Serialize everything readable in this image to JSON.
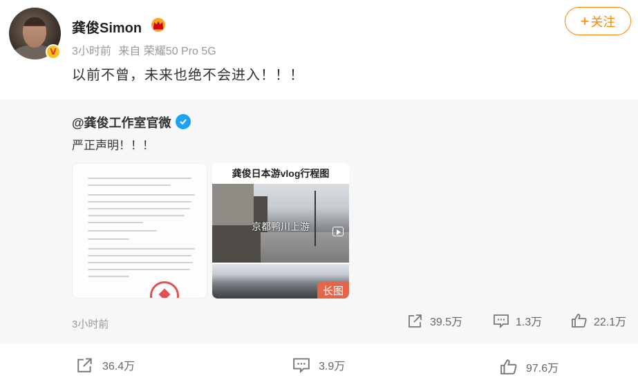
{
  "post": {
    "username": "龚俊Simon",
    "time": "3小时前",
    "source": "来自 荣耀50 Pro 5G",
    "content": "以前不曾，未来也绝不会进入！！！",
    "follow_label": "关注",
    "follow_plus": "+",
    "avatar_badge": "V",
    "colors": {
      "accent": "#ff8200",
      "gold": "#f5c416",
      "verified_blue": "#1da1f2"
    }
  },
  "repost": {
    "author": "@龚俊工作室官微",
    "text": "严正声明！！！",
    "images": [
      {
        "icon": "document-statement-image"
      },
      {
        "title": "龚俊日本游vlog行程图",
        "caption": "京都鸭川上游",
        "tag": "长图"
      }
    ],
    "time": "3小时前",
    "stats": {
      "reposts": "39.5万",
      "comments": "1.3万",
      "likes": "22.1万"
    }
  },
  "footer": {
    "reposts": "36.4万",
    "comments": "3.9万",
    "likes": "97.6万"
  }
}
